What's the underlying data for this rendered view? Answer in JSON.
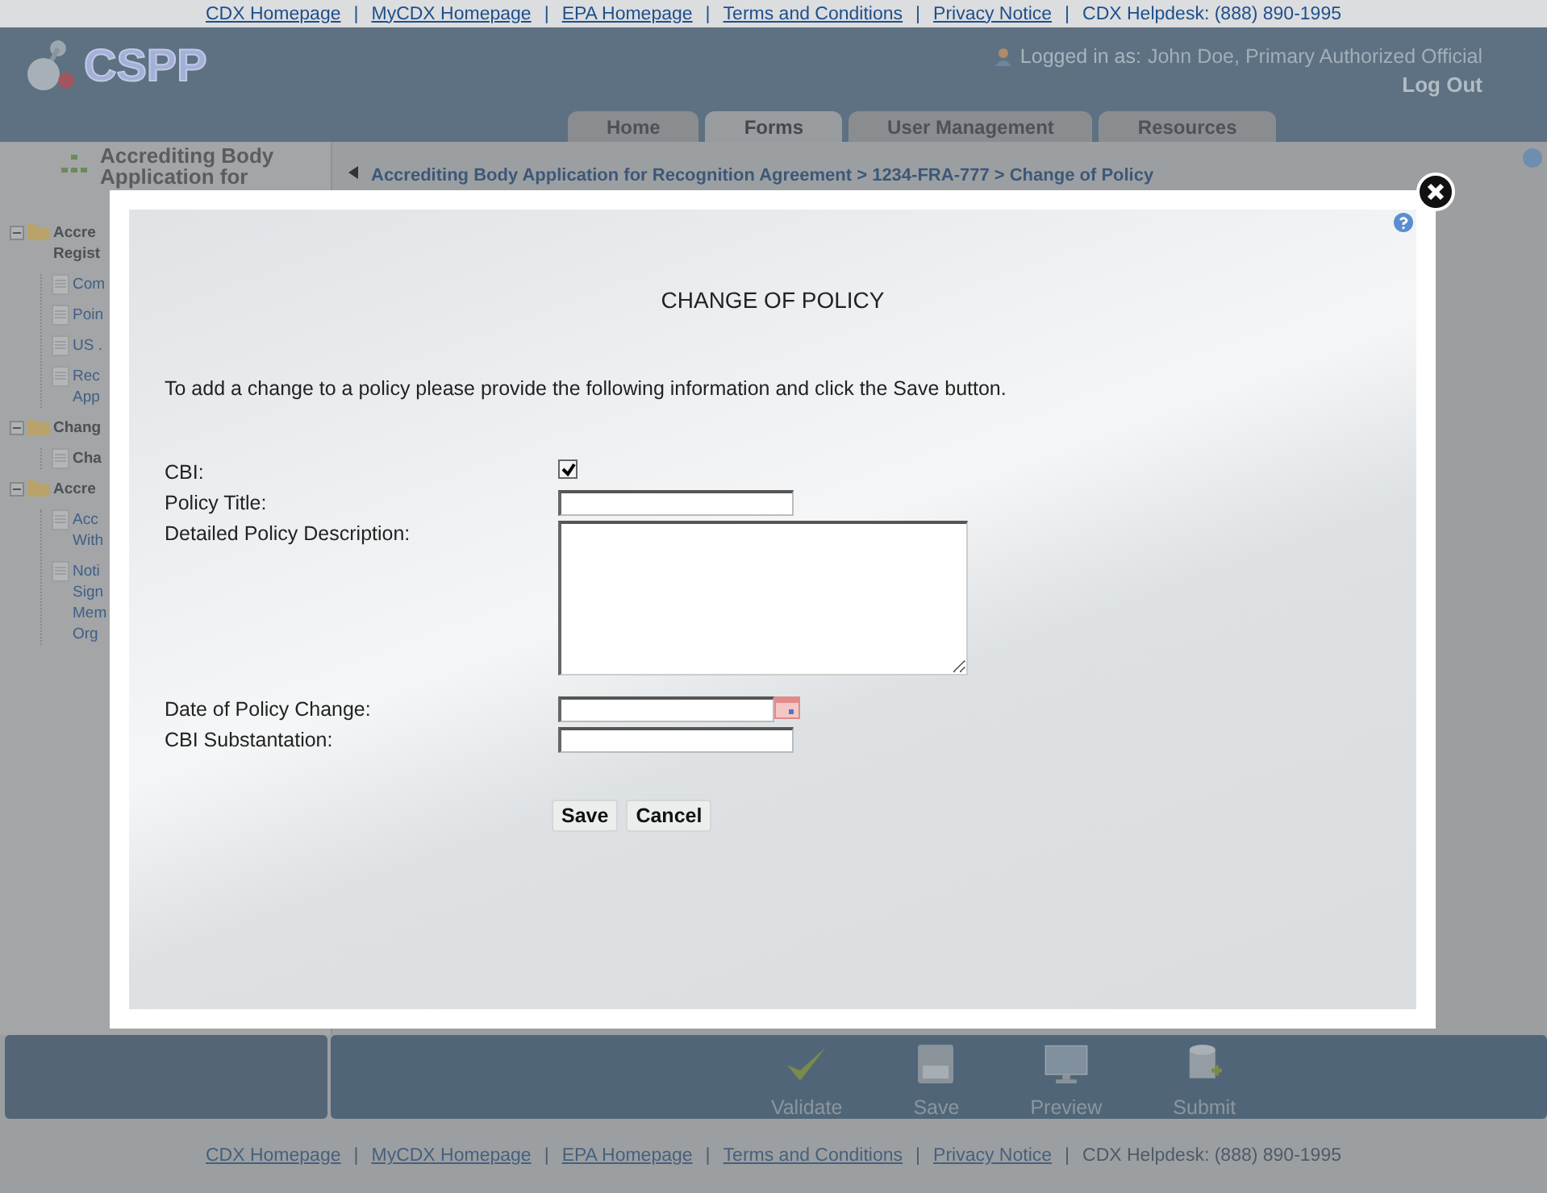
{
  "link_separator": "|",
  "top_links": [
    {
      "kind": "link",
      "label": "CDX Homepage"
    },
    {
      "kind": "link",
      "label": "MyCDX Homepage"
    },
    {
      "kind": "link",
      "label": "EPA Homepage"
    },
    {
      "kind": "link",
      "label": "Terms and Conditions"
    },
    {
      "kind": "link",
      "label": "Privacy Notice"
    },
    {
      "kind": "text",
      "label": "CDX Helpdesk: (888) 890-1995"
    }
  ],
  "header": {
    "logo": "CSPP",
    "logged_in_label": "Logged in as:",
    "user": "John Doe, Primary Authorized Official",
    "logout": "Log Out"
  },
  "tabs": [
    {
      "label": "Home",
      "selected": false
    },
    {
      "label": "Forms",
      "selected": true
    },
    {
      "label": "User Management",
      "selected": false
    },
    {
      "label": "Resources",
      "selected": false
    }
  ],
  "sidebar": {
    "title_lines": [
      "Accrediting Body",
      "Application for"
    ],
    "tree": [
      {
        "kind": "folder",
        "lines": [
          "Accre",
          "Regist"
        ],
        "expanded": true,
        "children": [
          {
            "kind": "doc",
            "lines": [
              "Com"
            ],
            "selected": false
          },
          {
            "kind": "doc",
            "lines": [
              "Poin"
            ],
            "selected": false
          },
          {
            "kind": "doc",
            "lines": [
              "US ."
            ],
            "selected": false
          },
          {
            "kind": "doc",
            "lines": [
              "Rec",
              "App"
            ],
            "selected": false
          }
        ]
      },
      {
        "kind": "folder",
        "lines": [
          "Chang"
        ],
        "expanded": true,
        "children": [
          {
            "kind": "doc",
            "lines": [
              "Cha"
            ],
            "selected": true
          }
        ]
      },
      {
        "kind": "folder",
        "lines": [
          "Accre"
        ],
        "expanded": true,
        "children": [
          {
            "kind": "doc",
            "lines": [
              "Acc",
              "With"
            ],
            "selected": false
          },
          {
            "kind": "doc",
            "lines": [
              "Noti",
              "Sign",
              "Mem",
              "Org"
            ],
            "selected": false
          }
        ]
      }
    ]
  },
  "breadcrumb": "Accrediting Body Application for Recognition Agreement > 1234-FRA-777 > Change of Policy",
  "dialog": {
    "title": "CHANGE OF POLICY",
    "instructions": "To add a change to a policy please provide the following information and click the Save button.",
    "fields": [
      {
        "kind": "checkbox",
        "label": "CBI:",
        "checked": true
      },
      {
        "kind": "text",
        "label": "Policy Title:"
      },
      {
        "kind": "textarea",
        "label": "Detailed Policy Description:"
      },
      {
        "kind": "date",
        "label": "Date of Policy Change:"
      },
      {
        "kind": "text",
        "label": "CBI Substantation:"
      }
    ],
    "buttons": [
      "Save",
      "Cancel"
    ]
  },
  "toolbar": [
    {
      "kind": "validate",
      "label": "Validate"
    },
    {
      "kind": "save",
      "label": "Save"
    },
    {
      "kind": "preview",
      "label": "Preview"
    },
    {
      "kind": "submit",
      "label": "Submit"
    }
  ],
  "footer_links": [
    {
      "kind": "link",
      "label": "CDX Homepage"
    },
    {
      "kind": "link",
      "label": "MyCDX Homepage"
    },
    {
      "kind": "link",
      "label": "EPA Homepage"
    },
    {
      "kind": "link",
      "label": "Terms and Conditions"
    },
    {
      "kind": "link",
      "label": "Privacy Notice"
    },
    {
      "kind": "text",
      "label": "CDX Helpdesk: (888) 890-1995"
    }
  ]
}
